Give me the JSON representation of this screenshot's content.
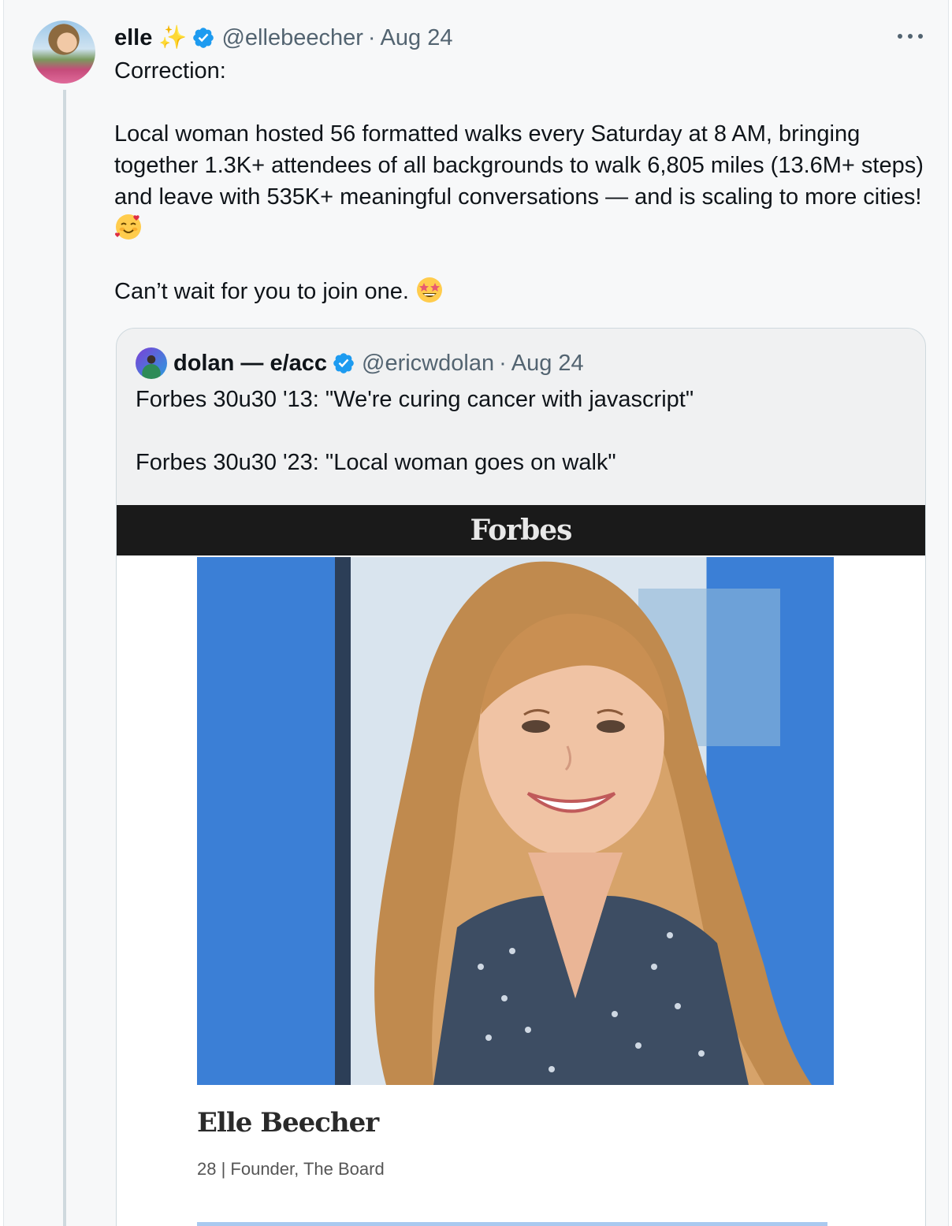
{
  "author": {
    "name": "elle",
    "handle": "@ellebeecher",
    "separator": "·",
    "date": "Aug 24"
  },
  "tweet": {
    "line1": "Correction:",
    "para2": "Local woman hosted 56 formatted walks every Saturday at 8 AM, bringing together 1.3K+ attendees of all backgrounds to walk 6,805 miles (13.6M+ steps) and leave with 535K+ meaningful conversations — and is scaling to more cities!",
    "para3": "Can’t wait for you to join one."
  },
  "quoted": {
    "name": "dolan — e/acc",
    "handle": "@ericwdolan",
    "separator": "·",
    "date": "Aug 24",
    "line1": "Forbes 30u30 '13: \"We're curing cancer with javascript\"",
    "line2": "Forbes 30u30 '23: \"Local woman goes on walk\""
  },
  "media": {
    "brand": "Forbes",
    "profile_name": "Elle Beecher",
    "profile_subtitle": "28 | Founder, The Board"
  },
  "colors": {
    "verified": "#1d9bf0",
    "muted": "#536471",
    "text": "#0f1419",
    "thread_line": "#cfd9de"
  },
  "icons": {
    "sparkle": "sparkles-emoji",
    "verified": "verified-badge-icon",
    "more": "more-icon",
    "emoji1": "smiling-face-with-hearts-emoji",
    "emoji2": "star-struck-emoji"
  }
}
